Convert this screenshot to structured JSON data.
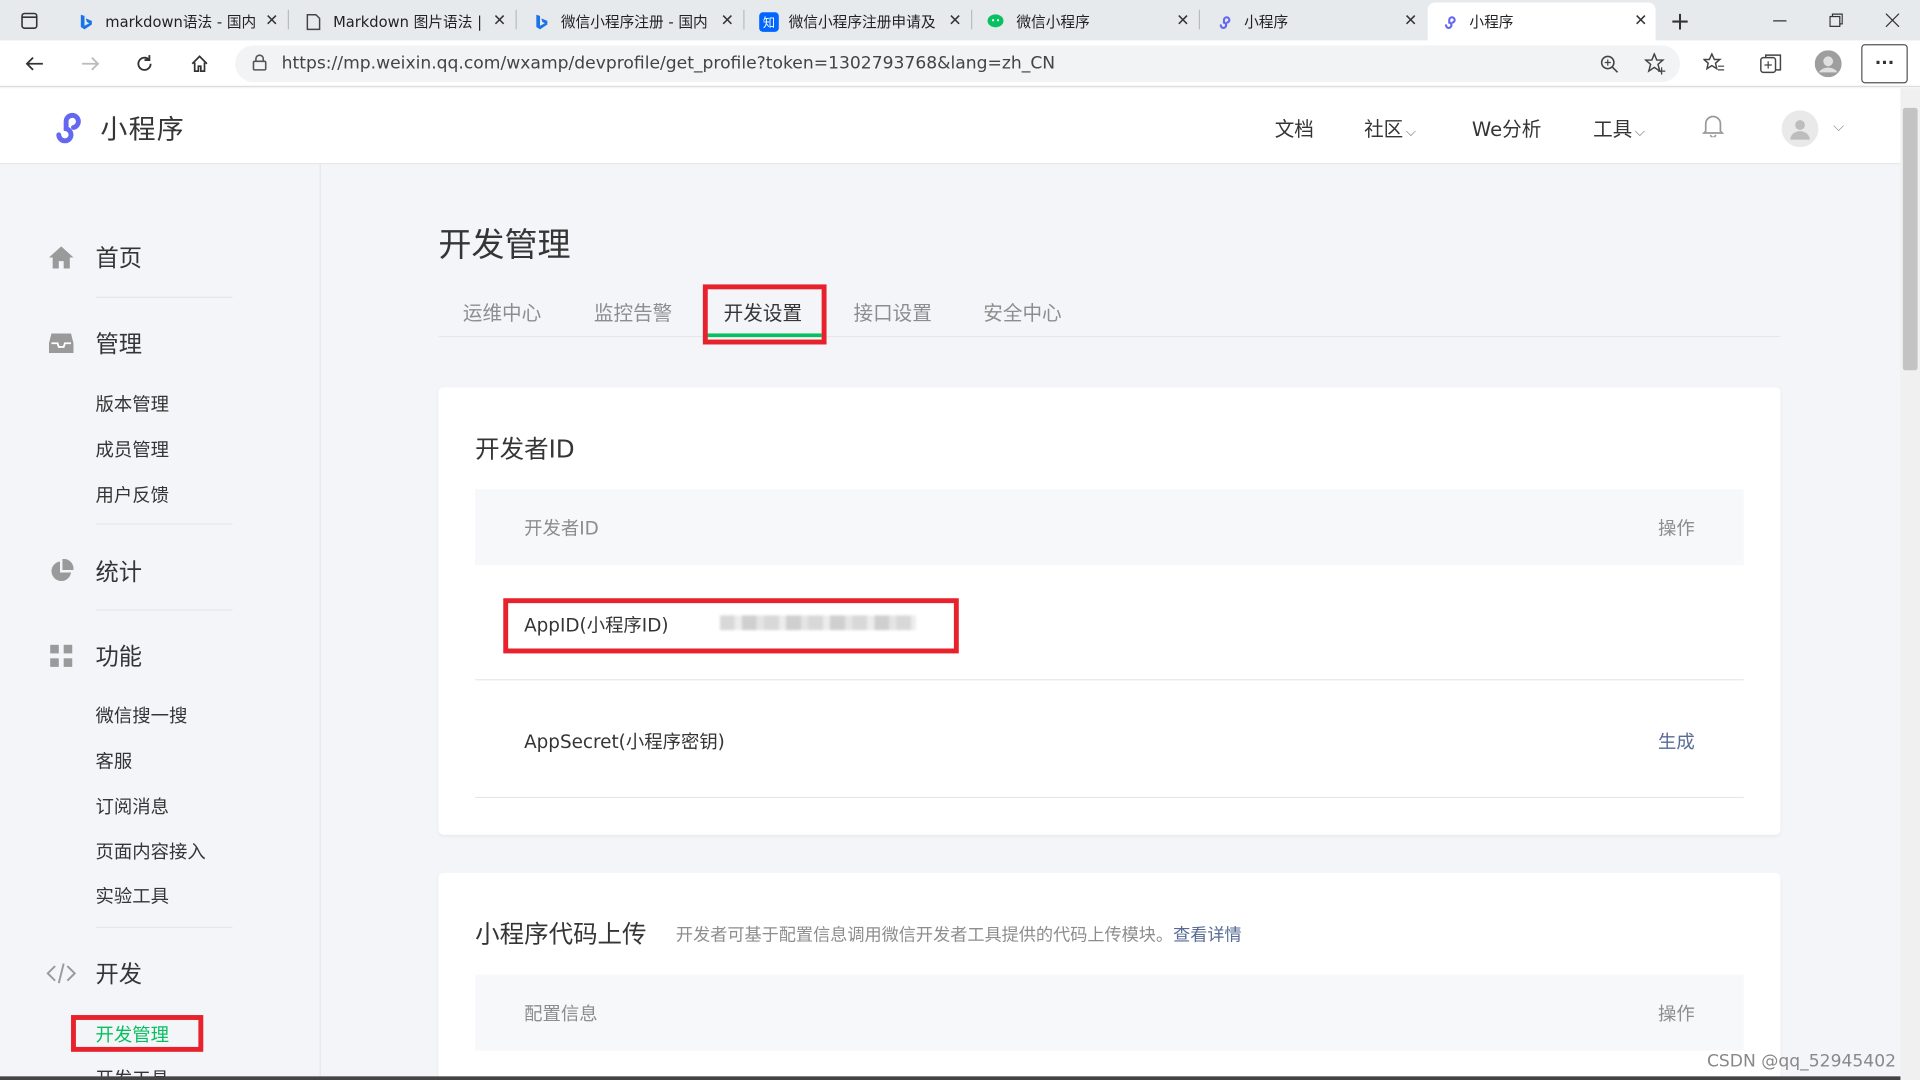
{
  "browser": {
    "tabs": [
      {
        "title": "markdown语法 - 国内",
        "icon": "bing-icon",
        "color": "#1a73e8"
      },
      {
        "title": "Markdown 图片语法 |",
        "icon": "page-icon",
        "color": "#555555"
      },
      {
        "title": "微信小程序注册 - 国内",
        "icon": "bing-icon",
        "color": "#1a73e8"
      },
      {
        "title": "微信小程序注册申请及",
        "icon": "zhihu-icon",
        "color": "#0066ff"
      },
      {
        "title": "微信小程序",
        "icon": "wechat-icon",
        "color": "#07c160"
      },
      {
        "title": "小程序",
        "icon": "miniprogram-icon",
        "color": "#6467f0"
      },
      {
        "title": "小程序",
        "icon": "miniprogram-icon",
        "color": "#6467f0"
      }
    ],
    "zhihu_glyph": "知",
    "new_tab": "+",
    "url": "https://mp.weixin.qq.com/wxamp/devprofile/get_profile?token=1302793768&lang=zh_CN",
    "more": "···"
  },
  "header": {
    "logo_text": "小程序",
    "nav": [
      {
        "label": "文档",
        "has_dropdown": false
      },
      {
        "label": "社区",
        "has_dropdown": true
      },
      {
        "label": "We分析",
        "has_dropdown": false
      },
      {
        "label": "工具",
        "has_dropdown": true
      }
    ]
  },
  "sidebar": {
    "home": "首页",
    "manage": {
      "label": "管理",
      "items": [
        "版本管理",
        "成员管理",
        "用户反馈"
      ]
    },
    "stats": "统计",
    "features": {
      "label": "功能",
      "items": [
        "微信搜一搜",
        "客服",
        "订阅消息",
        "页面内容接入",
        "实验工具"
      ]
    },
    "dev": {
      "label": "开发",
      "items": [
        "开发管理",
        "开发工具"
      ],
      "active": "开发管理"
    }
  },
  "main": {
    "title": "开发管理",
    "tabs": [
      "运维中心",
      "监控告警",
      "开发设置",
      "接口设置",
      "安全中心"
    ],
    "active_tab": "开发设置",
    "developer_id": {
      "title": "开发者ID",
      "col_name": "开发者ID",
      "col_action": "操作",
      "appid_label": "AppID(小程序ID)",
      "secret_label": "AppSecret(小程序密钥)",
      "secret_action": "生成"
    },
    "upload": {
      "title": "小程序代码上传",
      "desc": "开发者可基于配置信息调用微信开发者工具提供的代码上传模块。",
      "link": "查看详情",
      "col_config": "配置信息",
      "col_action": "操作"
    }
  },
  "watermark": "CSDN @qq_52945402",
  "colors": {
    "accent": "#07c160",
    "link": "#576b95",
    "highlight": "#e7222c",
    "brand": "#6467f0"
  }
}
